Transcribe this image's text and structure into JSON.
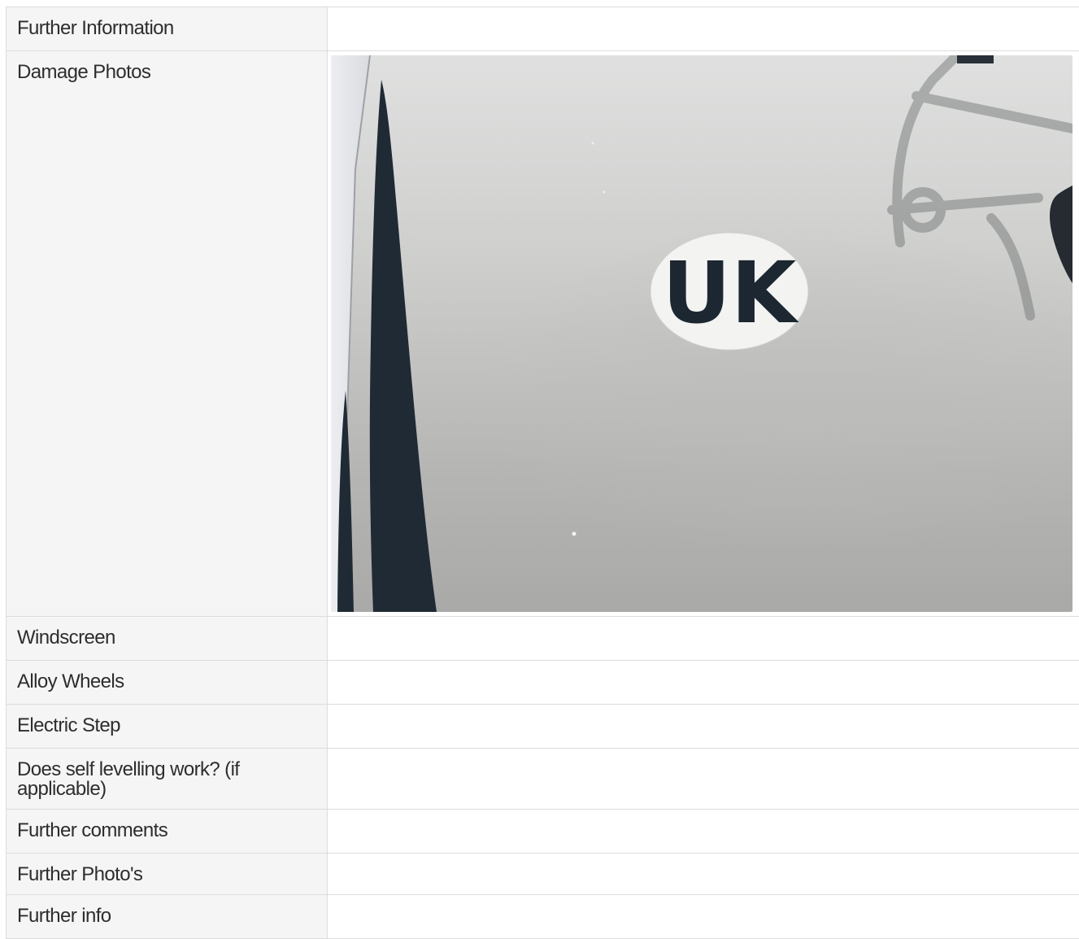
{
  "rows": [
    {
      "label": "Further Information"
    },
    {
      "label": "Damage Photos"
    },
    {
      "label": "Windscreen"
    },
    {
      "label": "Alloy Wheels"
    },
    {
      "label": "Electric Step"
    },
    {
      "label": "Does self levelling work? (if applicable)"
    },
    {
      "label": "Further comments"
    },
    {
      "label": "Further Photo's"
    },
    {
      "label": "Further info"
    }
  ],
  "damage_photo": {
    "sticker_text": "UK"
  }
}
